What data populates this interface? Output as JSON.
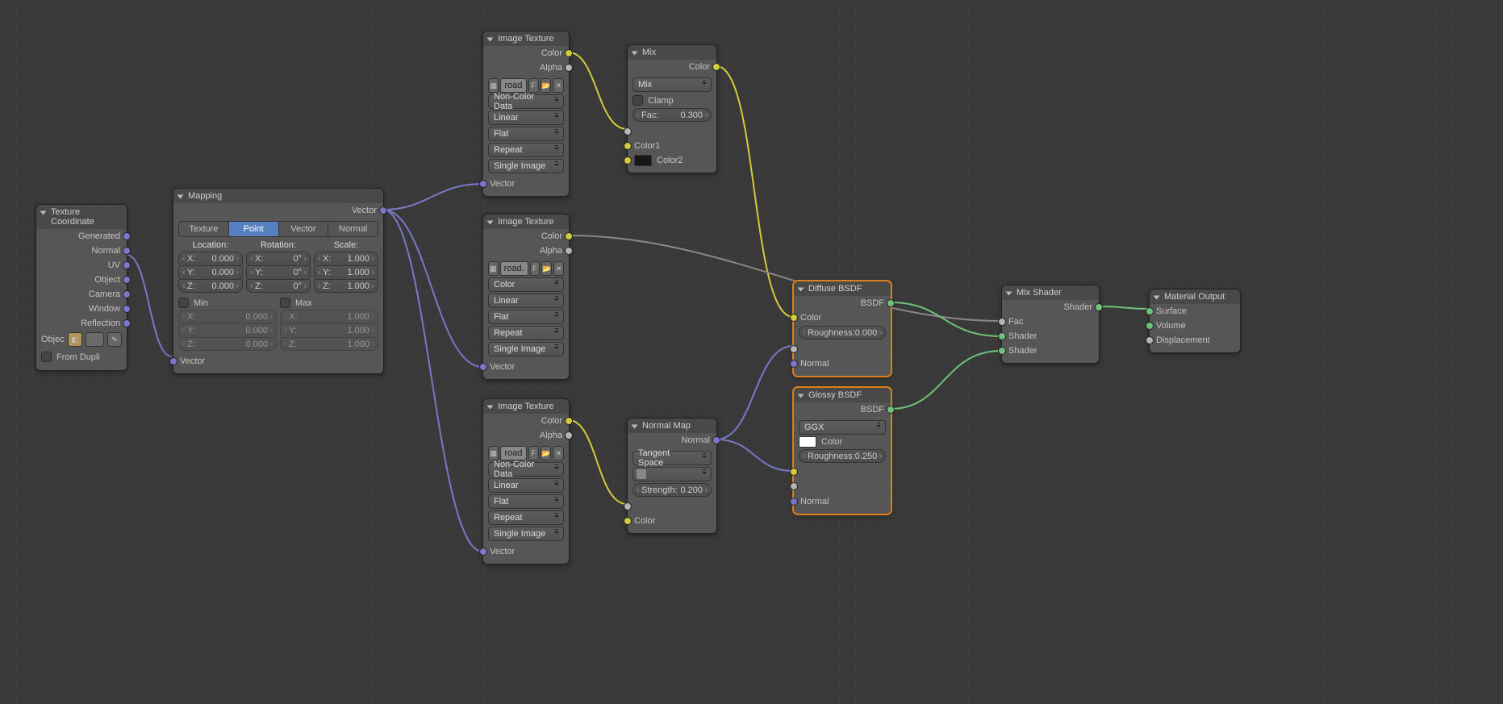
{
  "nodes": {
    "texcoord": {
      "title": "Texture Coordinate",
      "outGenerated": "Generated",
      "outNormal": "Normal",
      "outUV": "UV",
      "outObject": "Object",
      "outCamera": "Camera",
      "outWindow": "Window",
      "outReflection": "Reflection",
      "objectLabel": "Objec",
      "fromDupli": "From Dupli"
    },
    "mapping": {
      "title": "Mapping",
      "outVector": "Vector",
      "tabs": [
        "Texture",
        "Point",
        "Vector",
        "Normal"
      ],
      "activeTab": 1,
      "locationLabel": "Location:",
      "rotationLabel": "Rotation:",
      "scaleLabel": "Scale:",
      "loc": {
        "x": "X:",
        "y": "Y:",
        "z": "Z:",
        "xv": "0.000",
        "yv": "0.000",
        "zv": "0.000"
      },
      "rot": {
        "x": "X:",
        "y": "Y:",
        "z": "Z:",
        "xv": "0°",
        "yv": "0°",
        "zv": "0°"
      },
      "scl": {
        "x": "X:",
        "y": "Y:",
        "z": "Z:",
        "xv": "1.000",
        "yv": "1.000",
        "zv": "1.000"
      },
      "minLabel": "Min",
      "maxLabel": "Max",
      "min": {
        "xv": "0.000",
        "yv": "0.000",
        "zv": "0.000"
      },
      "max": {
        "xv": "1.000",
        "yv": "1.000",
        "zv": "1.000"
      },
      "inVector": "Vector"
    },
    "imgtex1": {
      "title": "Image Texture",
      "outColor": "Color",
      "outAlpha": "Alpha",
      "imgName": "road",
      "fake": "F",
      "colorMode": "Non-Color Data",
      "interp": "Linear",
      "proj": "Flat",
      "rep": "Repeat",
      "source": "Single Image",
      "inVector": "Vector"
    },
    "imgtex2": {
      "title": "Image Texture",
      "outColor": "Color",
      "outAlpha": "Alpha",
      "imgName": "road.",
      "fake": "F",
      "colorMode": "Color",
      "interp": "Linear",
      "proj": "Flat",
      "rep": "Repeat",
      "source": "Single Image",
      "inVector": "Vector"
    },
    "imgtex3": {
      "title": "Image Texture",
      "outColor": "Color",
      "outAlpha": "Alpha",
      "imgName": "road",
      "fake": "F",
      "colorMode": "Non-Color Data",
      "interp": "Linear",
      "proj": "Flat",
      "rep": "Repeat",
      "source": "Single Image",
      "inVector": "Vector"
    },
    "mix": {
      "title": "Mix",
      "outColor": "Color",
      "blend": "Mix",
      "clamp": "Clamp",
      "facLabel": "Fac:",
      "facVal": "0.300",
      "inColor1": "Color1",
      "inColor2": "Color2"
    },
    "normalmap": {
      "title": "Normal Map",
      "outNormal": "Normal",
      "space": "Tangent Space",
      "strengthLabel": "Strength:",
      "strengthVal": "0.200",
      "inColor": "Color"
    },
    "diffuse": {
      "title": "Diffuse BSDF",
      "outBSDF": "BSDF",
      "inColor": "Color",
      "roughLabel": "Roughness:",
      "roughVal": "0.000",
      "inNormal": "Normal"
    },
    "glossy": {
      "title": "Glossy BSDF",
      "outBSDF": "BSDF",
      "dist": "GGX",
      "inColorLabel": "Color",
      "roughLabel": "Roughness:",
      "roughVal": "0.250",
      "inNormal": "Normal"
    },
    "mixshader": {
      "title": "Mix Shader",
      "outShader": "Shader",
      "inFac": "Fac",
      "inShader1": "Shader",
      "inShader2": "Shader"
    },
    "output": {
      "title": "Material Output",
      "inSurface": "Surface",
      "inVolume": "Volume",
      "inDisplacement": "Displacement"
    }
  }
}
